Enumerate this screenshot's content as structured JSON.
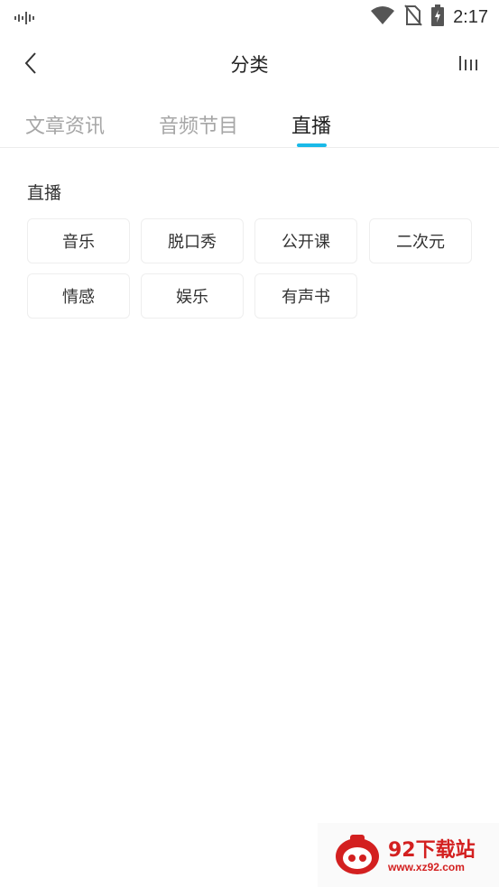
{
  "status_bar": {
    "time": "2:17",
    "icons": [
      "audio-wave-icon",
      "wifi-icon",
      "no-sim-icon",
      "battery-charging-icon"
    ]
  },
  "header": {
    "title": "分类",
    "back_icon": "chevron-left-icon",
    "menu_icon": "bars-icon"
  },
  "tabs": [
    {
      "label": "文章资讯",
      "active": false
    },
    {
      "label": "音频节目",
      "active": false
    },
    {
      "label": "直播",
      "active": true
    }
  ],
  "accent_color": "#19b9e8",
  "section": {
    "title": "直播",
    "items": [
      "音乐",
      "脱口秀",
      "公开课",
      "二次元",
      "情感",
      "娱乐",
      "有声书"
    ]
  },
  "watermark": {
    "name": "92下载站",
    "url": "www.xz92.com"
  }
}
